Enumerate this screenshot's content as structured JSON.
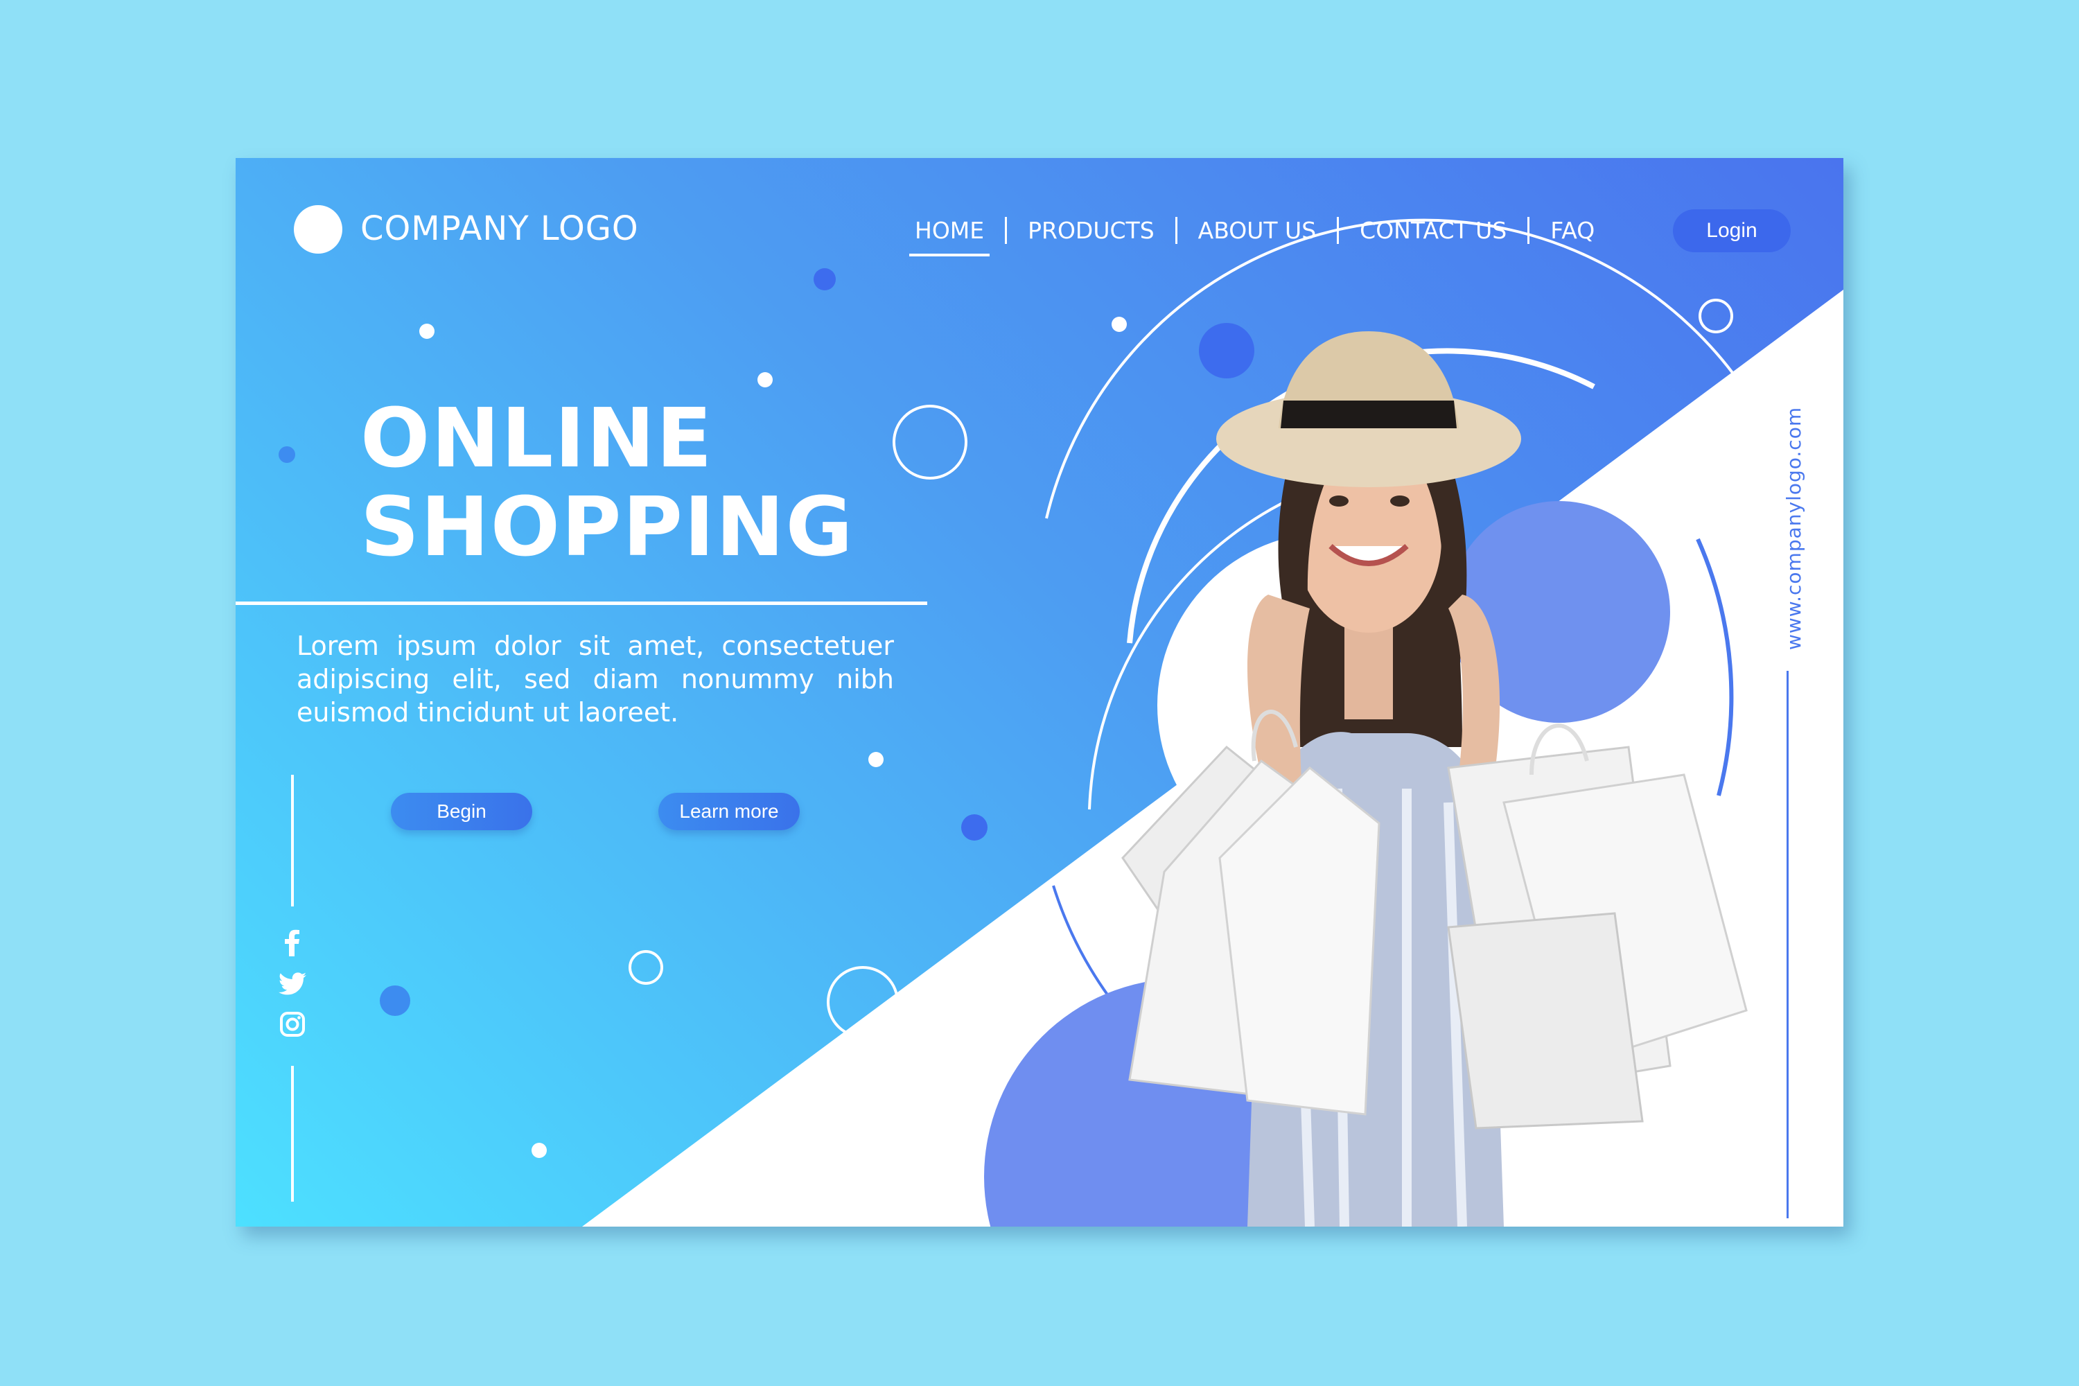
{
  "header": {
    "logo_text": "COMPANY LOGO",
    "nav": [
      "HOME",
      "PRODUCTS",
      "ABOUT US",
      "CONTACT US",
      "FAQ"
    ],
    "active_nav": "HOME",
    "login_label": "Login"
  },
  "hero": {
    "title_line1": "ONLINE",
    "title_line2": "SHOPPING",
    "description": "Lorem ipsum dolor sit amet, consectetuer adipiscing elit, sed diam nonummy nibh euismod tincidunt ut laoreet.",
    "begin_label": "Begin",
    "learn_more_label": "Learn more"
  },
  "social": {
    "icons": [
      "facebook-icon",
      "twitter-icon",
      "instagram-icon"
    ]
  },
  "side": {
    "url": "www.companylogo.com"
  },
  "colors": {
    "gradient_top": "#4a74ee",
    "gradient_bottom": "#4de0ff",
    "accent": "#3c68ec",
    "background": "#8fe0f7"
  }
}
